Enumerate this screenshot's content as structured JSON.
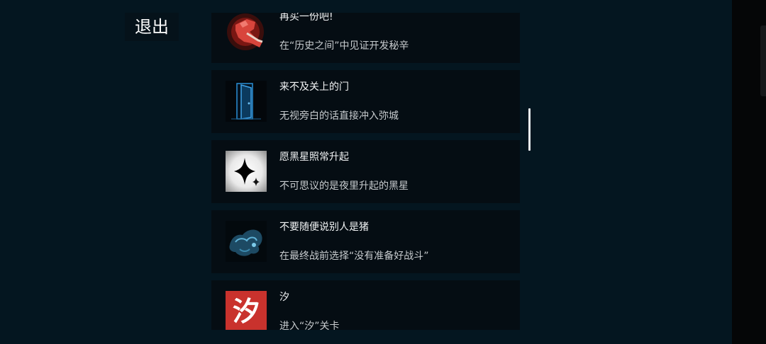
{
  "exit_label": "退出",
  "achievements": [
    {
      "title": "再买一份吧!",
      "desc": "在“历史之间”中见证开发秘辛",
      "icon": "fist-icon"
    },
    {
      "title": "来不及关上的门",
      "desc": "无视旁白的话直接冲入弥城",
      "icon": "door-icon"
    },
    {
      "title": "愿黑星照常升起",
      "desc": "不可思议的是夜里升起的黑星",
      "icon": "black-star-icon"
    },
    {
      "title": "不要随便说别人是猪",
      "desc": "在最终战前选择“没有准备好战斗”",
      "icon": "pig-creature-icon"
    },
    {
      "title": "汐",
      "desc": "进入“汐”关卡",
      "icon": "xi-character-icon",
      "icon_text": "汐"
    }
  ],
  "colors": {
    "background": "#041620",
    "card": "#050d13",
    "accent_red": "#c9322d",
    "accent_blue": "#2a8fd6"
  }
}
